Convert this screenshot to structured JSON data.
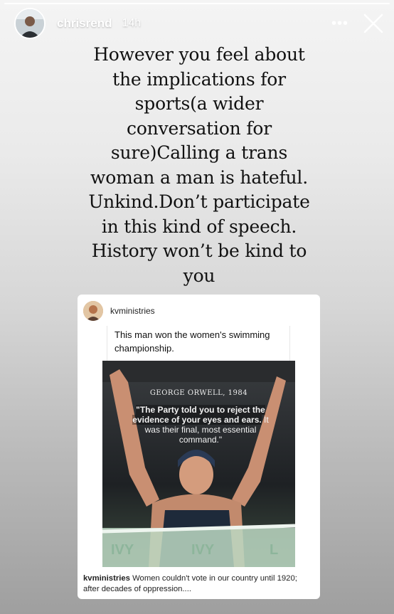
{
  "story": {
    "username": "chrisrend",
    "timestamp": "14h",
    "caption": "However you feel about\nthe implications for\nsports(a wider\nconversation for\nsure)Calling a trans\nwoman a man is hateful.\nUnkind.Don’t participate\nin this kind of speech.\nHistory won’t be kind to\nyou",
    "more_label": "•••"
  },
  "post": {
    "username": "kvministries",
    "quoted_text": "This man won the women's swimming championship.",
    "image": {
      "quote_author": "GEORGE ORWELL, 1984",
      "quote_bold": "\"The Party told you to reject the evidence of your eyes and ears.",
      "quote_rest": " It was their final, most essential command.\""
    },
    "caption_user": "kvministries",
    "caption_text": " Women couldn't vote in our country until 1920; after decades of oppression...."
  },
  "colors": {
    "text": "#111111",
    "white": "#ffffff",
    "photo_bg": "#222222",
    "banner": "#c9e0c9"
  },
  "icons": {
    "more": "more-icon",
    "close": "close-icon"
  }
}
